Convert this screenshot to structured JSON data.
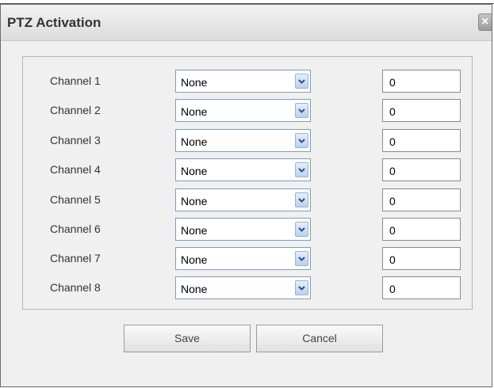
{
  "dialog": {
    "title": "PTZ Activation",
    "close_label": "×"
  },
  "channels": [
    {
      "label": "Channel 1",
      "type": "None",
      "value": "0"
    },
    {
      "label": "Channel 2",
      "type": "None",
      "value": "0"
    },
    {
      "label": "Channel 3",
      "type": "None",
      "value": "0"
    },
    {
      "label": "Channel 4",
      "type": "None",
      "value": "0"
    },
    {
      "label": "Channel 5",
      "type": "None",
      "value": "0"
    },
    {
      "label": "Channel 6",
      "type": "None",
      "value": "0"
    },
    {
      "label": "Channel 7",
      "type": "None",
      "value": "0"
    },
    {
      "label": "Channel 8",
      "type": "None",
      "value": "0"
    }
  ],
  "buttons": {
    "save_label": "Save",
    "cancel_label": "Cancel"
  },
  "icons": {
    "close": "close-icon",
    "dropdown": "chevron-down-icon"
  }
}
